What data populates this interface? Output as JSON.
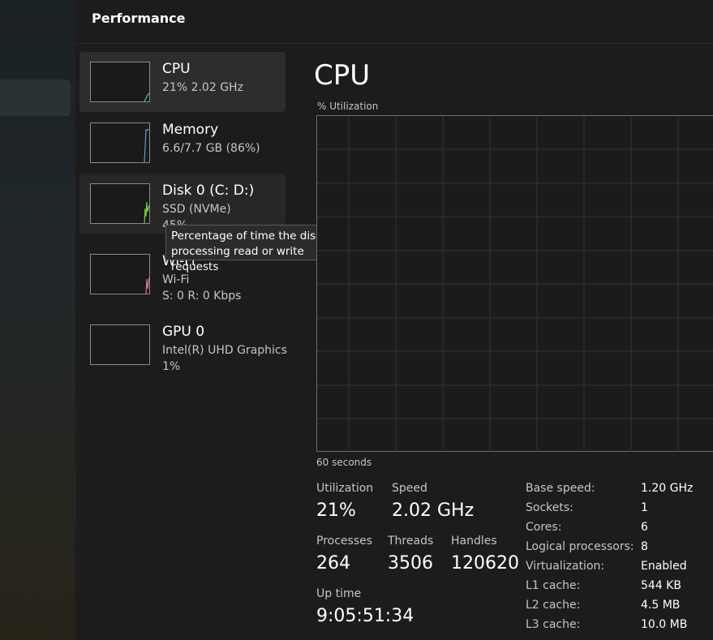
{
  "header": {
    "title": "Performance"
  },
  "colors": {
    "cpu_accent": "#4ab8d6",
    "memory_accent": "#6f8fd6",
    "disk_accent": "#7ac943",
    "wifi_accent": "#e0709a",
    "gpu_accent": "#8a8a8a"
  },
  "sidebar": {
    "items": [
      {
        "name": "CPU",
        "line1": "21%  2.02 GHz",
        "line2": "",
        "level": 0.21
      },
      {
        "name": "Memory",
        "line1": "6.6/7.7 GB (86%)",
        "line2": "",
        "level": 0.86
      },
      {
        "name": "Disk 0 (C: D:)",
        "line1": "SSD (NVMe)",
        "line2": "45%",
        "level": 0.45
      },
      {
        "name": "Wi-Fi",
        "line1": "Wi-Fi",
        "line2": "S: 0  R: 0 Kbps",
        "level": 0.6
      },
      {
        "name": "GPU 0",
        "line1": "Intel(R) UHD Graphics",
        "line2": "1%",
        "level": 0.01
      }
    ]
  },
  "tooltip": {
    "line1": "Percentage of time the disk is",
    "line2": "processing read or write requests"
  },
  "detail": {
    "title": "CPU",
    "utilization_label": "% Utilization",
    "time_label": "60 seconds",
    "stats": {
      "utilization": {
        "label": "Utilization",
        "value": "21%"
      },
      "speed": {
        "label": "Speed",
        "value": "2.02 GHz"
      },
      "processes": {
        "label": "Processes",
        "value": "264"
      },
      "threads": {
        "label": "Threads",
        "value": "3506"
      },
      "handles": {
        "label": "Handles",
        "value": "120620"
      },
      "uptime": {
        "label": "Up time",
        "value": "9:05:51:34"
      }
    },
    "specs": [
      {
        "key": "Base speed:",
        "value": "1.20 GHz"
      },
      {
        "key": "Sockets:",
        "value": "1"
      },
      {
        "key": "Cores:",
        "value": "6"
      },
      {
        "key": "Logical processors:",
        "value": "8"
      },
      {
        "key": "Virtualization:",
        "value": "Enabled"
      },
      {
        "key": "L1 cache:",
        "value": "544 KB"
      },
      {
        "key": "L2 cache:",
        "value": "4.5 MB"
      },
      {
        "key": "L3 cache:",
        "value": "10.0 MB"
      }
    ]
  }
}
